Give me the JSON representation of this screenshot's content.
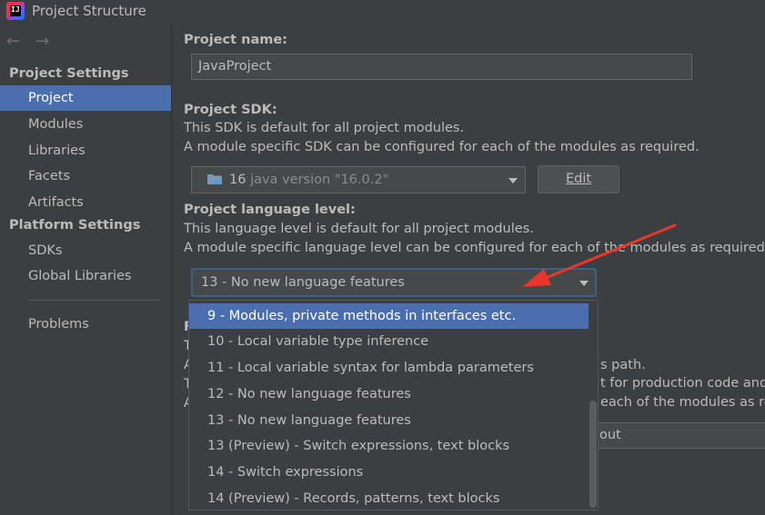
{
  "window": {
    "title": "Project Structure",
    "app_icon_text": "IJ"
  },
  "sidebar": {
    "project_settings_header": "Project Settings",
    "project_items": [
      {
        "label": "Project",
        "selected": true
      },
      {
        "label": "Modules"
      },
      {
        "label": "Libraries"
      },
      {
        "label": "Facets"
      },
      {
        "label": "Artifacts"
      }
    ],
    "platform_settings_header": "Platform Settings",
    "platform_items": [
      {
        "label": "SDKs"
      },
      {
        "label": "Global Libraries"
      }
    ],
    "problems_label": "Problems"
  },
  "main": {
    "project_name_label": "Project name:",
    "project_name_value": "JavaProject",
    "sdk_label": "Project SDK:",
    "sdk_desc_1": "This SDK is default for all project modules.",
    "sdk_desc_2": "A module specific SDK can be configured for each of the modules as required.",
    "sdk_value_version": "16",
    "sdk_value_detail": "java version \"16.0.2\"",
    "edit_button_label": "Edit",
    "lang_level_label": "Project language level:",
    "lang_desc_1": "This language level is default for all project modules.",
    "lang_desc_2": "A module specific language level can be configured for each of the modules as required",
    "lang_level_value": "13 - No new language features",
    "behind_popup": {
      "row1": "F",
      "row2_left": "T",
      "row2_right": "s path.",
      "row3_left": "A",
      "row3_right": "t for production code and",
      "row4_left": "T",
      "row4_right": "each of the modules as re",
      "row5_left": "A",
      "output_field_value": "out"
    }
  },
  "dropdown": {
    "options": [
      {
        "label": "9 - Modules, private methods in interfaces etc.",
        "highlighted": true
      },
      {
        "label": "10 - Local variable type inference"
      },
      {
        "label": "11 - Local variable syntax for lambda parameters"
      },
      {
        "label": "12 - No new language features"
      },
      {
        "label": "13 - No new language features"
      },
      {
        "label": "13 (Preview) - Switch expressions, text blocks"
      },
      {
        "label": "14 - Switch expressions"
      },
      {
        "label": "14 (Preview) - Records, patterns, text blocks"
      }
    ]
  },
  "colors": {
    "background": "#3c3f41",
    "selection": "#4b6eaf",
    "field": "#45494a",
    "focus_border": "#3d6185",
    "annotation_arrow": "#e8362d"
  },
  "icons": [
    "back-arrow-icon",
    "forward-arrow-icon",
    "folder-icon",
    "chevron-down-icon",
    "annotation-arrow-icon"
  ]
}
